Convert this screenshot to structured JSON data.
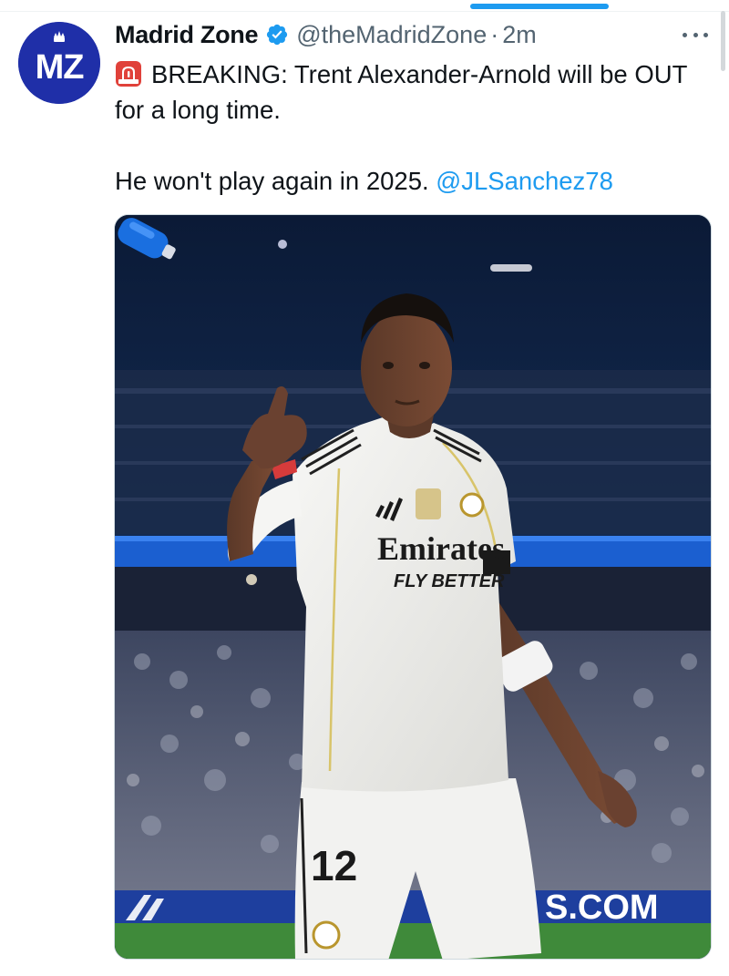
{
  "tweet": {
    "display_name": "Madrid Zone",
    "handle": "@theMadridZone",
    "separator": "·",
    "time": "2m",
    "text_line1": "BREAKING: Trent Alexander-Arnold will be OUT for a long time.",
    "text_line2": "He won't play again in 2025.",
    "mention": "@JLSanchez78",
    "siren_icon": "rotating-light-emoji",
    "more_icon": "more-horizontal-icon",
    "verified_icon": "verified-badge-icon"
  },
  "avatar": {
    "text": "MZ",
    "background": "#1f2fa8"
  },
  "media": {
    "sponsor_top": "Emirates",
    "sponsor_bottom": "FLY BETTER",
    "shirt_number": "12",
    "board_text": "S.COM"
  },
  "colors": {
    "accent": "#1d9bf0",
    "text": "#0f1419",
    "muted": "#536471"
  }
}
